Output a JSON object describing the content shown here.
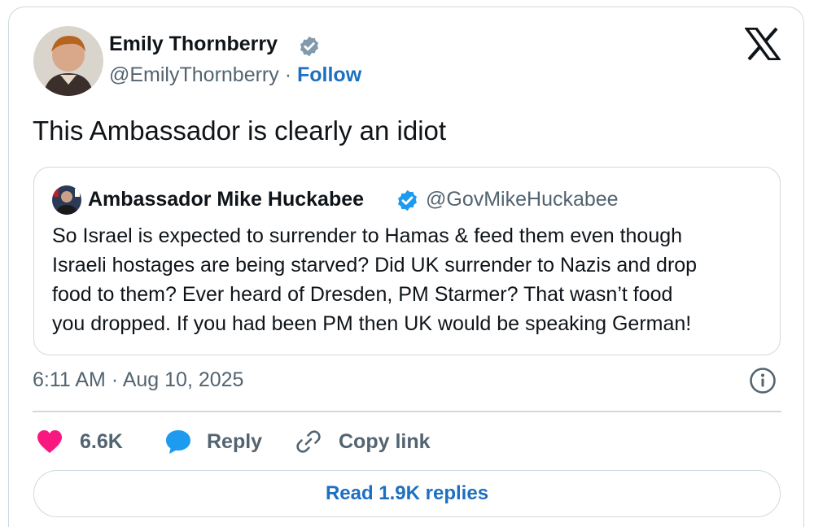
{
  "author": {
    "name": "Emily Thornberry",
    "handle": "@EmilyThornberry",
    "separator": "·",
    "follow_label": "Follow",
    "verified_badge_color": "#829aab"
  },
  "tweet": {
    "text": "This Ambassador is clearly an idiot",
    "timestamp": "6:11 AM · Aug 10, 2025"
  },
  "quoted": {
    "name": "Ambassador Mike Huckabee",
    "handle": "@GovMikeHuckabee",
    "verified_badge_color": "#1d9bf0",
    "text": "So Israel is expected to surrender to Hamas & feed them even though\nIsraeli hostages are being starved?  Did UK surrender to Nazis and drop\nfood to them? Ever heard of Dresden, PM Starmer?  That wasn’t food\nyou dropped. If you had been PM then UK would be speaking German!"
  },
  "actions": {
    "like_count": "6.6K",
    "reply_label": "Reply",
    "copy_label": "Copy link"
  },
  "read_replies_label": "Read 1.9K replies",
  "colors": {
    "like": "#f91880",
    "reply": "#1d9bf0",
    "link": "#1d6fc1",
    "secondary_text": "#536471",
    "border": "#cfd9de"
  },
  "icons": [
    "verified-badge-icon",
    "x-logo-icon",
    "info-icon",
    "heart-icon",
    "reply-bubble-icon",
    "link-icon"
  ]
}
